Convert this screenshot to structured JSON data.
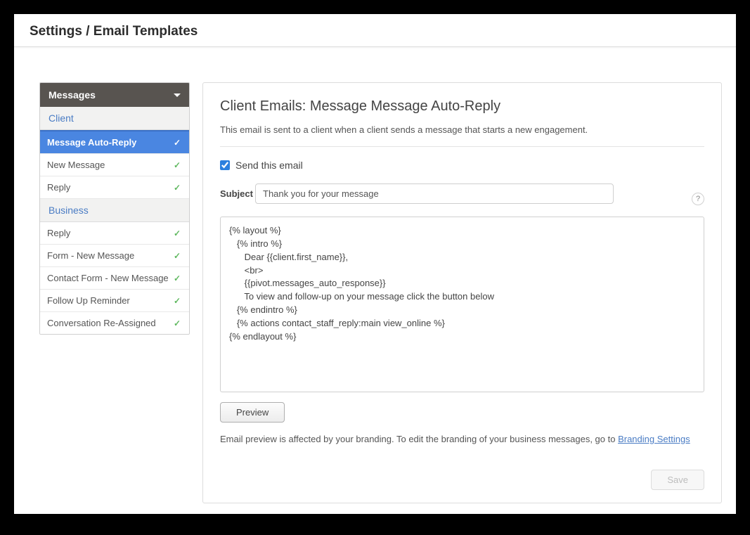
{
  "page_title": "Settings / Email Templates",
  "sidebar": {
    "header": "Messages",
    "groups": [
      {
        "label": "Client",
        "items": [
          {
            "label": "Message Auto-Reply",
            "selected": true
          },
          {
            "label": "New Message",
            "selected": false
          },
          {
            "label": "Reply",
            "selected": false
          }
        ]
      },
      {
        "label": "Business",
        "items": [
          {
            "label": "Reply",
            "selected": false
          },
          {
            "label": "Form - New Message",
            "selected": false
          },
          {
            "label": "Contact Form - New Message",
            "selected": false
          },
          {
            "label": "Follow Up Reminder",
            "selected": false
          },
          {
            "label": "Conversation Re-Assigned",
            "selected": false
          }
        ]
      }
    ]
  },
  "main": {
    "heading": "Client Emails: Message Message Auto-Reply",
    "description": "This email is sent to a client when a client sends a message that starts a new engagement.",
    "send_checkbox_label": "Send this email",
    "send_checked": true,
    "subject_label": "Subject",
    "subject_value": "Thank you for your message",
    "body": "{% layout %}\n   {% intro %}\n      Dear {{client.first_name}},\n      <br>\n      {{pivot.messages_auto_response}}\n      To view and follow-up on your message click the button below\n   {% endintro %}\n   {% actions contact_staff_reply:main view_online %}\n{% endlayout %}",
    "preview_label": "Preview",
    "hint_prefix": "Email preview is affected by your branding. To edit the branding of your business messages, go to ",
    "hint_link": "Branding Settings",
    "save_label": "Save",
    "help_icon": "?"
  }
}
